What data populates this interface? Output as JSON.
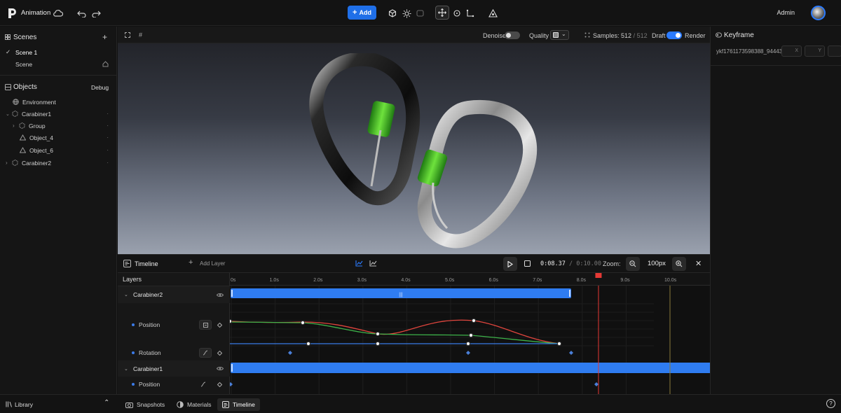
{
  "app": {
    "title": "Animation"
  },
  "toolbar": {
    "add_label": "Add",
    "user": "Admin"
  },
  "scenes": {
    "title": "Scenes",
    "items": [
      {
        "label": "Scene 1"
      },
      {
        "label": "Scene"
      }
    ]
  },
  "objects": {
    "title": "Objects",
    "debug_label": "Debug",
    "items": [
      {
        "label": "Environment"
      },
      {
        "label": "Carabiner1"
      },
      {
        "label": "Group"
      },
      {
        "label": "Object_4"
      },
      {
        "label": "Object_6"
      },
      {
        "label": "Carabiner2"
      }
    ]
  },
  "viewport": {
    "denoise_label": "Denoise",
    "denoise_on": false,
    "quality_label": "Quality",
    "samples_label": "Samples:",
    "samples_current": "512",
    "samples_sep": "/",
    "samples_total": "512",
    "draft_label": "Draft",
    "render_label": "Render",
    "render_on": true
  },
  "keyframe_panel": {
    "title": "Keyframe",
    "id": "ykf1761173598388_94443",
    "x_label": "X",
    "y_label": "Y"
  },
  "timeline": {
    "title": "Timeline",
    "add_layer_label": "Add Layer",
    "time_current": "0:08.37",
    "time_sep": "/",
    "time_total": "0:10.00",
    "zoom_label": "Zoom:",
    "zoom_value": "100px",
    "layers_label": "Layers",
    "ticks": [
      "0s",
      "1.0s",
      "2.0s",
      "3.0s",
      "4.0s",
      "5.0s",
      "6.0s",
      "7.0s",
      "8.0s",
      "9.0s",
      "10.0s"
    ],
    "tracks": [
      {
        "label": "Carabiner2"
      },
      {
        "label": "Position"
      },
      {
        "label": "Rotation"
      },
      {
        "label": "Carabiner1"
      },
      {
        "label": "Position"
      }
    ],
    "playhead_seconds": 8.37,
    "duration_seconds": 10
  },
  "bottom": {
    "library_label": "Library",
    "tabs": [
      {
        "label": "Snapshots"
      },
      {
        "label": "Materials"
      },
      {
        "label": "Timeline"
      }
    ]
  },
  "colors": {
    "accent": "#2b7bff",
    "curve_red": "#e0453d",
    "curve_green": "#3db24a",
    "playhead": "#e53935"
  }
}
